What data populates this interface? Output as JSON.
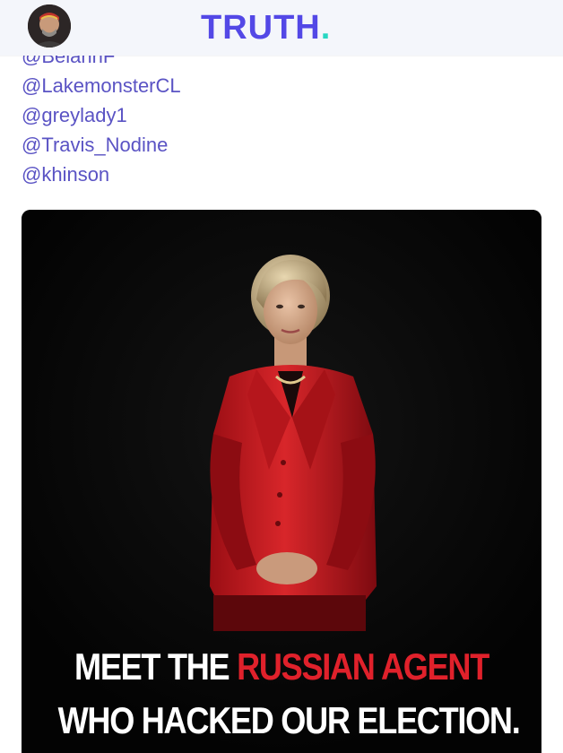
{
  "header": {
    "brand": "TRUTH",
    "brand_dot": ".",
    "brand_color": "#5348e6",
    "dot_color": "#27d7c2",
    "avatar_icon": "user-avatar"
  },
  "mentions": [
    "@BelannF",
    "@LakemonsterCL",
    "@greylady1",
    "@Travis_Nodine",
    "@khinson"
  ],
  "image": {
    "caption_line1_white": "MEET THE",
    "caption_line1_red": "RUSSIAN AGENT",
    "caption_line2": "WHO HACKED OUR ELECTION.",
    "caption_red_color": "#e0212b"
  }
}
